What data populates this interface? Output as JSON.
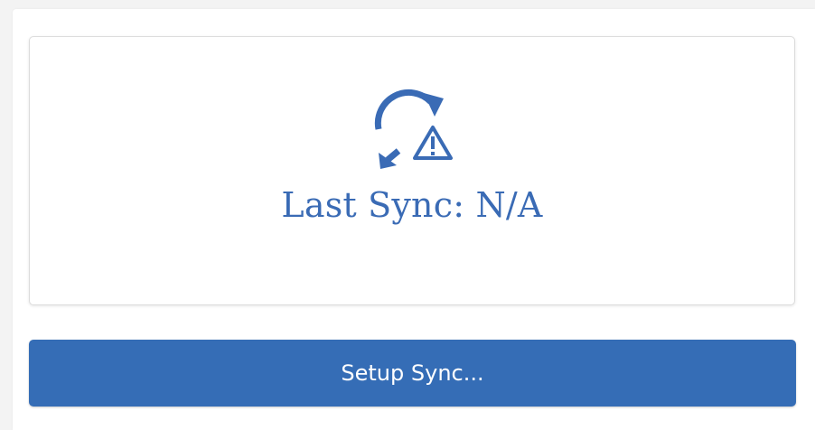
{
  "sync_status": {
    "label": "Last Sync: N/A",
    "icon": "sync-warning-icon"
  },
  "actions": {
    "setup_label": "Setup Sync..."
  },
  "colors": {
    "accent": "#356db6",
    "status_text": "#3a6bb5",
    "icon": "#3a6bb5"
  }
}
